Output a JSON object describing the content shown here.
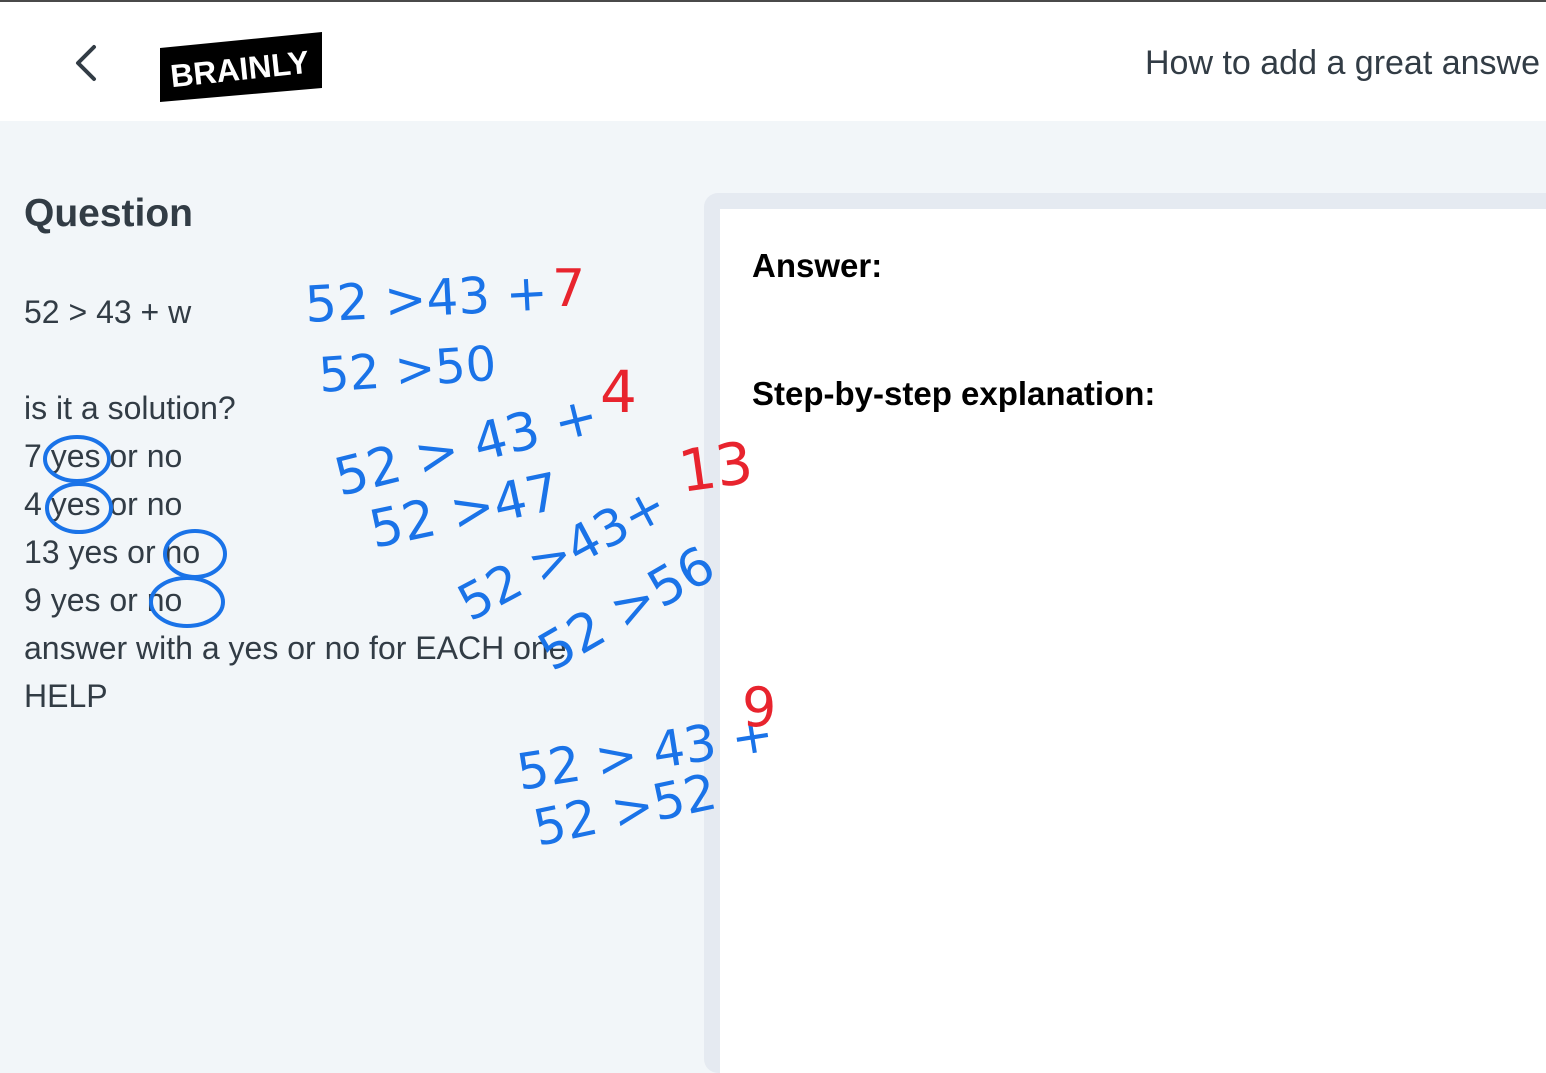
{
  "header": {
    "back_icon": "chevron-left-icon",
    "logo_text": "BRAINLY",
    "help_link": "How to add a great answe"
  },
  "question": {
    "heading": "Question",
    "lines": [
      "52 > 43 + w",
      "is it a solution?",
      "7 yes or no",
      "4 yes or no",
      "13 yes or no",
      "9 yes or no",
      "answer with a yes or no for EACH one",
      "HELP"
    ]
  },
  "answer": {
    "answer_label": "Answer:",
    "steps_label": "Step-by-step explanation:"
  },
  "handwriting": {
    "blue_color": "#1a73e8",
    "red_color": "#e8242e",
    "work": [
      {
        "expr": "52 >43 +",
        "value": "7",
        "result": "52 >50"
      },
      {
        "expr": "52 > 43 +",
        "value": "4",
        "result": "52 >47"
      },
      {
        "expr": "52 >43+",
        "value": "13",
        "result": "52 >56"
      },
      {
        "expr": "52 > 43 +",
        "value": "9",
        "result": "52 >52"
      }
    ]
  }
}
